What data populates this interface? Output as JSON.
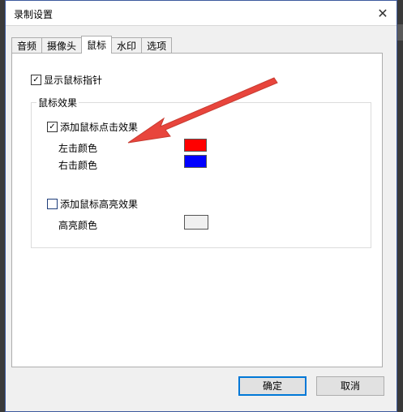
{
  "dialog": {
    "title": "录制设置",
    "close_icon": "close-icon"
  },
  "tabs": [
    {
      "label": "音频"
    },
    {
      "label": "摄像头"
    },
    {
      "label": "鼠标",
      "active": true
    },
    {
      "label": "水印"
    },
    {
      "label": "选项"
    }
  ],
  "mouse": {
    "show_pointer_label": "显示鼠标指针",
    "show_pointer_checked": true,
    "group_title": "鼠标效果",
    "click_effect_label": "添加鼠标点击效果",
    "click_effect_checked": true,
    "left_click_label": "左击颜色",
    "left_click_color": "#ff0000",
    "right_click_label": "右击颜色",
    "right_click_color": "#0000ff",
    "highlight_effect_label": "添加鼠标高亮效果",
    "highlight_effect_checked": false,
    "highlight_color_label": "高亮颜色",
    "highlight_color": "#f0f0f0"
  },
  "buttons": {
    "ok": "确定",
    "cancel": "取消"
  },
  "annotation": {
    "arrow_color": "#e8453c"
  }
}
